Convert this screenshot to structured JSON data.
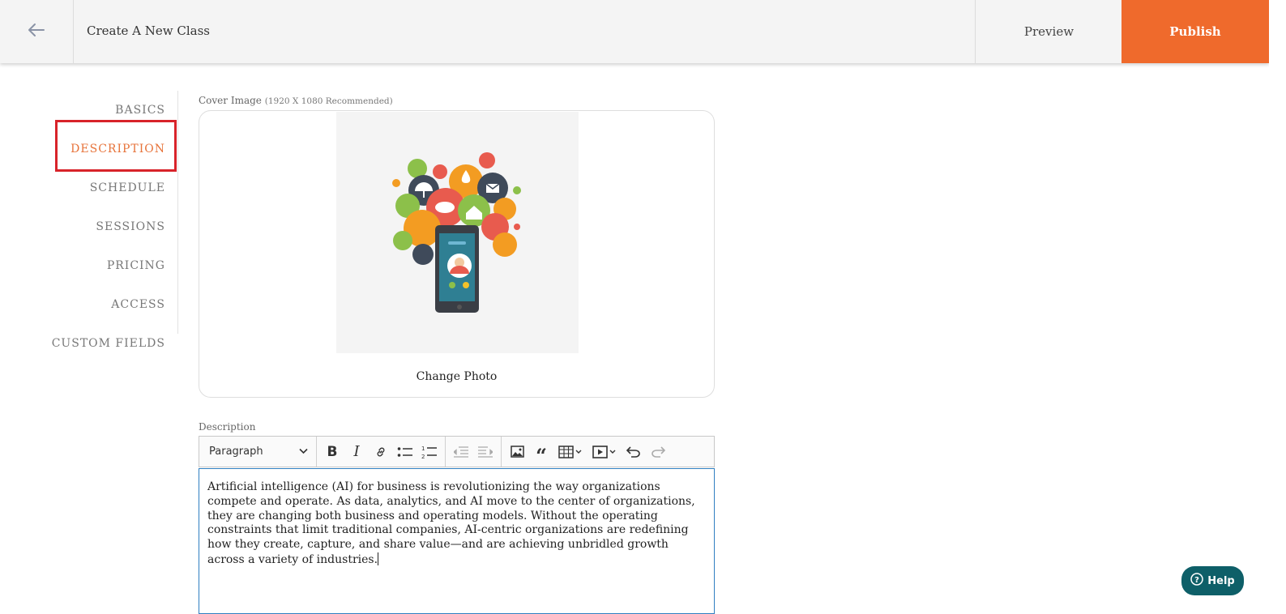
{
  "header": {
    "back_icon": "arrow-left-icon",
    "title": "Create A New Class",
    "preview_label": "Preview",
    "publish_label": "Publish",
    "accent_color": "#ef6a2c"
  },
  "sidebar": {
    "items": [
      {
        "label": "BASICS",
        "active": false
      },
      {
        "label": "DESCRIPTION",
        "active": true
      },
      {
        "label": "SCHEDULE",
        "active": false
      },
      {
        "label": "SESSIONS",
        "active": false
      },
      {
        "label": "PRICING",
        "active": false
      },
      {
        "label": "ACCESS",
        "active": false
      },
      {
        "label": "CUSTOM FIELDS",
        "active": false
      }
    ],
    "highlight_color": "#d8232a"
  },
  "cover": {
    "label": "Cover Image",
    "hint": "(1920 X 1080 Recommended)",
    "change_photo_label": "Change Photo"
  },
  "description": {
    "label": "Description",
    "toolbar": {
      "format_value": "Paragraph",
      "buttons": [
        "bold-icon",
        "italic-icon",
        "link-icon",
        "bulleted-list-icon",
        "numbered-list-icon",
        "outdent-icon",
        "indent-icon",
        "image-icon",
        "blockquote-icon",
        "table-icon",
        "media-icon",
        "undo-icon",
        "redo-icon"
      ]
    },
    "text": "Artificial intelligence (AI) for business is revolutionizing the way organizations compete and operate. As data, analytics, and AI move to the center of organizations, they are changing both business and operating models. Without the operating constraints that limit traditional companies, AI-centric organizations are redefining how they create, capture, and share value—and are achieving unbridled growth across a variety of industries."
  },
  "help": {
    "label": "Help",
    "icon": "question-circle-icon",
    "color": "#0e5f68"
  }
}
